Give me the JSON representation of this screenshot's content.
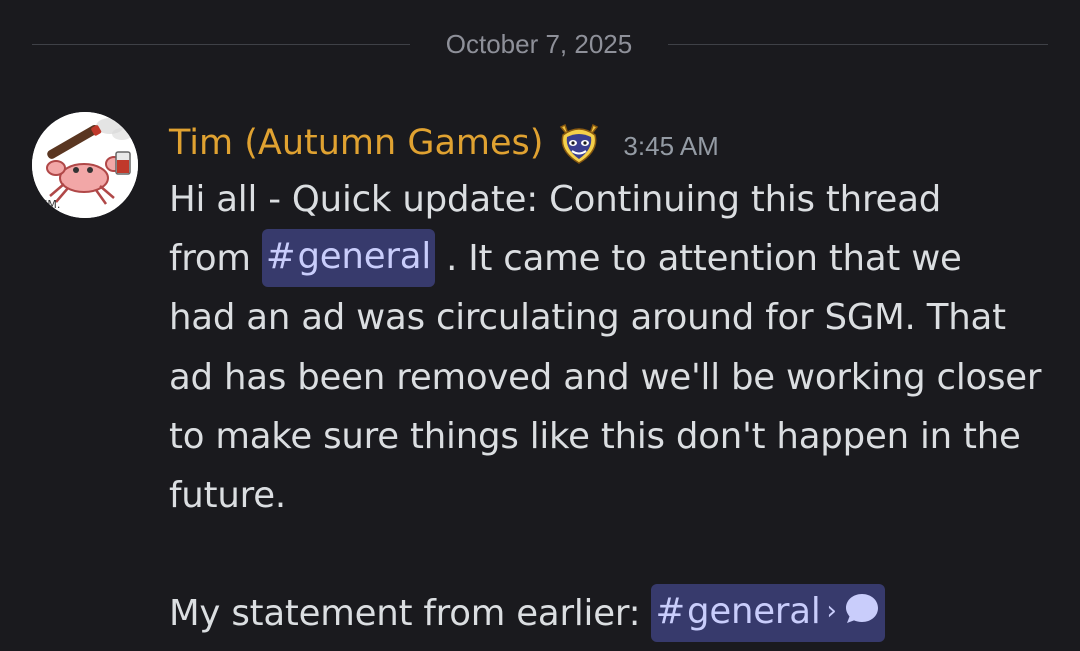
{
  "divider": {
    "date": "October 7, 2025"
  },
  "message": {
    "author": "Tim (Autumn Games)",
    "author_color": "#e0a231",
    "role_icon": "demon-badge-icon",
    "timestamp": "3:45 AM",
    "avatar_icon": "crab-avatar-icon",
    "line1": "Hi all - Quick update:  Continuing this thread",
    "line2_pre": "from ",
    "mention1_hash": "#",
    "mention1_name": "general",
    "line2_post": " . It came to attention that we",
    "line3": "had an ad was circulating around for SGM. That",
    "line4": "ad has been removed and we'll be working closer",
    "line5": "to make sure things like this don't happen in the",
    "line6": "future.",
    "line8_pre": "My statement from earlier: ",
    "mention2_hash": "#",
    "mention2_name": "general",
    "mention2_chevron": "›",
    "mention2_icon": "thread-bubble-icon"
  },
  "colors": {
    "background": "#1a1a1e",
    "text": "#dbdee1",
    "mention_bg": "#373a6c",
    "mention_text": "#c9cdfb",
    "timestamp": "#949ba4"
  }
}
